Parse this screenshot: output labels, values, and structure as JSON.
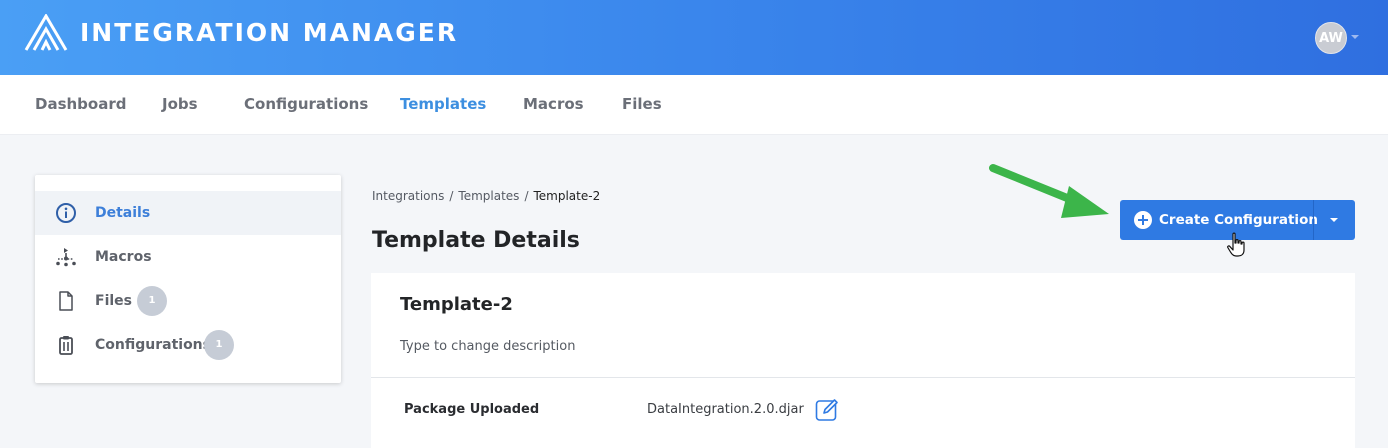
{
  "header": {
    "app_title": "INTEGRATION MANAGER",
    "logo_icon": "triangle-stripes-logo",
    "avatar_initials": "AW"
  },
  "nav": {
    "items": [
      {
        "label": "Dashboard",
        "active": false
      },
      {
        "label": "Jobs",
        "active": false
      },
      {
        "label": "Configurations",
        "active": false
      },
      {
        "label": "Templates",
        "active": true
      },
      {
        "label": "Macros",
        "active": false
      },
      {
        "label": "Files",
        "active": false
      }
    ]
  },
  "sidebar": {
    "items": [
      {
        "label": "Details",
        "icon": "info-icon",
        "active": true
      },
      {
        "label": "Macros",
        "icon": "flow-icon",
        "active": false
      },
      {
        "label": "Files",
        "icon": "file-icon",
        "badge": "1",
        "active": false
      },
      {
        "label": "Configurations",
        "icon": "clipboard-icon",
        "badge": "1",
        "active": false
      }
    ]
  },
  "breadcrumb": {
    "items": [
      "Integrations",
      "Templates",
      "Template-2"
    ],
    "separator": "/"
  },
  "page_title": "Template Details",
  "actions": {
    "create_label": "Create Configuration"
  },
  "card": {
    "title": "Template-2",
    "description_placeholder": "Type to change description",
    "package_label": "Package Uploaded",
    "package_value": "DataIntegration.2.0.djar"
  },
  "colors": {
    "header_gradient_start": "#4a9ff5",
    "header_gradient_end": "#2f6fe0",
    "accent": "#3d8fe0",
    "primary_button": "#2f7ae3",
    "annotation_arrow": "#3cb54a"
  }
}
